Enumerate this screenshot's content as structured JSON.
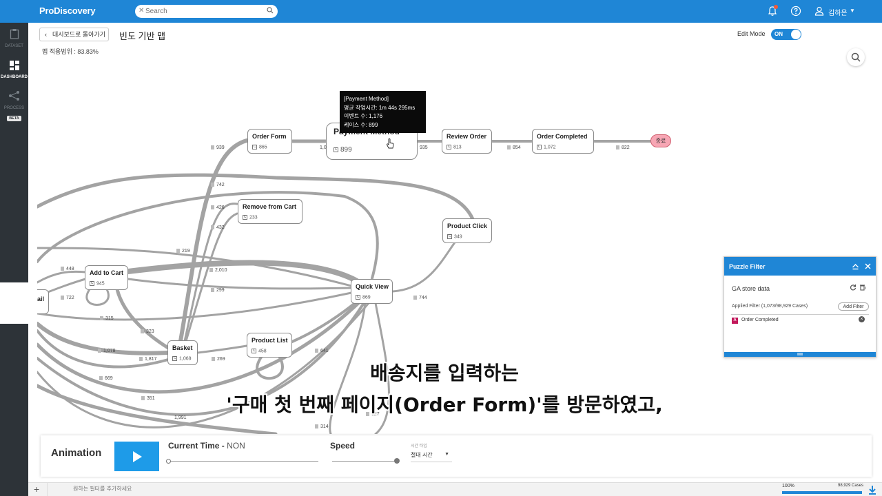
{
  "app": {
    "logo": "ProDiscovery",
    "search_placeholder": "Search",
    "user_name": "김하은"
  },
  "sidebar": {
    "items": [
      {
        "label": "DATASET",
        "icon": "clipboard-icon",
        "active": false
      },
      {
        "label": "DASHBOARD",
        "icon": "dashboard-icon",
        "active": true
      },
      {
        "label": "PROCESS",
        "icon": "process-icon",
        "active": false,
        "badge": "BETA"
      }
    ]
  },
  "header": {
    "back_label": "대시보드로 돌아가기",
    "title": "빈도 기반 맵",
    "coverage": "맵 적용범위 : 83.83%",
    "edit_mode_label": "Edit Mode",
    "edit_mode_state": "ON"
  },
  "map": {
    "nodes": [
      {
        "name": "Order Form",
        "count": "865"
      },
      {
        "name": "Payment Method",
        "count": "899"
      },
      {
        "name": "Review Order",
        "count": "813"
      },
      {
        "name": "Order Completed",
        "count": "1,072"
      },
      {
        "name": "Remove from Cart",
        "count": "233"
      },
      {
        "name": "Product Click",
        "count": "349"
      },
      {
        "name": "Add to Cart",
        "count": "945"
      },
      {
        "name": "Quick View",
        "count": "869"
      },
      {
        "name": "Basket",
        "count": "1,069"
      },
      {
        "name": "Product List",
        "count": "458"
      },
      {
        "name": "ail",
        "count": ""
      }
    ],
    "end_label": "종료",
    "edge_labels": [
      "939",
      "1,0",
      "935",
      "854",
      "822",
      "742",
      "426",
      "432",
      "219",
      "2,010",
      "299",
      "448",
      "722",
      "315",
      "323",
      "1,078",
      "1,817",
      "269",
      "641",
      "744",
      "669",
      "351",
      "1,991",
      "627",
      "314"
    ],
    "tooltip": {
      "title": "[Payment Method]",
      "avg_time": "평균 작업시간: 1m 44s 295ms",
      "events": "이벤트 수: 1,176",
      "cases": "케이스 수: 899"
    }
  },
  "puzzle_filter": {
    "title": "Puzzle Filter",
    "dataset": "GA  store  data",
    "applied": "Applied Filter (1,073/98,929 Cases)",
    "add_filter": "Add Filter",
    "items": [
      {
        "badge": "A",
        "label": "Order Completed"
      }
    ]
  },
  "subtitles": {
    "line1": "배송지를 입력하는",
    "line2": "'구매 첫 번째 페이지(Order Form)'를 방문하였고,"
  },
  "animation": {
    "title": "Animation",
    "current_time_label": "Current Time - ",
    "current_time_value": "NON",
    "speed_label": "Speed",
    "time_type_label": "시간 타입",
    "time_type_value": "절대 시간"
  },
  "bottom": {
    "filter_placeholder": "원하는 필터를 추가하세요",
    "percent": "100%",
    "cases": "98,929 Cases"
  },
  "colors": {
    "primary": "#1f86d6",
    "sidebar": "#2d3338",
    "edge": "#9e9e9e",
    "end_node": "#f7a6b4"
  }
}
